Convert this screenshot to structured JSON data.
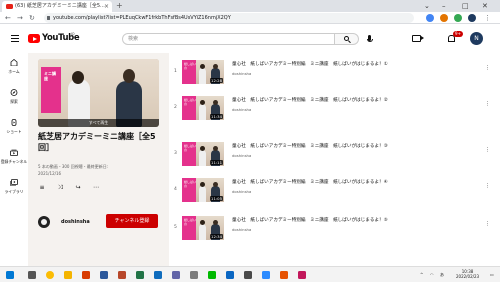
{
  "browser": {
    "tab_title": "(63) 紙芝居アカデミーミニ講座［全5...",
    "tab_close": "×",
    "new_tab": "+",
    "url": "youtube.com/playlist?list=PLEuqCkwF1frkbThFsfBs4UsVYiZ16nmjX2QY",
    "window_controls": [
      "⌄",
      "–",
      "□",
      "✕"
    ],
    "nav": [
      "←",
      "→",
      "↻"
    ]
  },
  "youtube": {
    "logo_text": "YouTube",
    "logo_suffix": "JP",
    "search_placeholder": "検索",
    "notification_count": "9+",
    "avatar_initial": "N"
  },
  "rail": [
    {
      "label": "ホーム",
      "icon": "home-icon"
    },
    {
      "label": "探索",
      "icon": "explore-icon"
    },
    {
      "label": "ショート",
      "icon": "shorts-icon"
    },
    {
      "label": "登録チャンネル",
      "icon": "subscriptions-icon"
    },
    {
      "label": "ライブラリ",
      "icon": "library-icon"
    }
  ],
  "playlist": {
    "thumb_banner": "ミニ講座",
    "play_all": "すべて再生",
    "title": "紙芝居アカデミーミニ講座［全5回］",
    "meta": "5 本の動画・300 回視聴・最終更新日:",
    "date": "2021/12/16",
    "channel": "doshinsha",
    "subscribe": "チャンネル登録"
  },
  "videos": [
    {
      "index": "1",
      "title": "童心社　紙しばいアカデミー特別編　ミニ講座　紙しばいがはじまるよ！①",
      "channel": "doshinsha",
      "duration": "12:28",
      "banner": "紙しばいの"
    },
    {
      "index": "2",
      "title": "童心社　紙しばいアカデミー特別編　ミニ講座　紙しばいがはじまるよ！②",
      "channel": "doshinsha",
      "duration": "11:34",
      "banner": "紙しばいの"
    },
    {
      "index": "3",
      "title": "童心社　紙しばいアカデミー特別編　ミニ講座　紙しばいがはじまるよ！③",
      "channel": "doshinsha",
      "duration": "11:11",
      "banner": "紙しばいの"
    },
    {
      "index": "4",
      "title": "童心社　紙しばいアカデミー特別編　ミニ講座　紙しばいがはじまるよ！④",
      "channel": "doshinsha",
      "duration": "11:05",
      "banner": "紙しばいの"
    },
    {
      "index": "5",
      "title": "童心社　紙しばいアカデミー特別編　ミニ講座　紙しばいがはじまるよ！⑤",
      "channel": "doshinsha",
      "duration": "12:34",
      "banner": "紙しばいの"
    }
  ],
  "taskbar": {
    "time": "10:38",
    "date": "2022/02/23",
    "lang": "あ"
  },
  "colors": {
    "yt_red": "#ff0000",
    "subscribe_red": "#cc0000",
    "accent_pink": "#e4318c"
  }
}
